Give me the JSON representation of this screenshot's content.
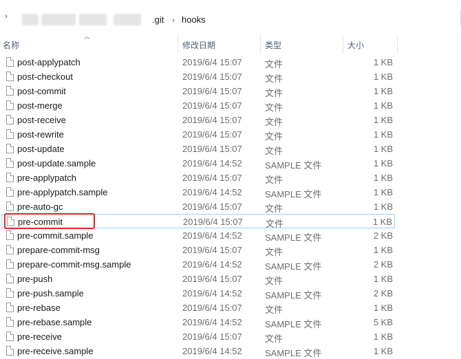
{
  "address": {
    "crumbs": [
      ".git",
      "hooks"
    ],
    "separator": "›",
    "chevron": "›"
  },
  "columns": {
    "name": "名称",
    "date": "修改日期",
    "type": "类型",
    "size": "大小"
  },
  "files": [
    {
      "name": "post-applypatch",
      "date": "2019/6/4 15:07",
      "type": "文件",
      "size": "1 KB"
    },
    {
      "name": "post-checkout",
      "date": "2019/6/4 15:07",
      "type": "文件",
      "size": "1 KB"
    },
    {
      "name": "post-commit",
      "date": "2019/6/4 15:07",
      "type": "文件",
      "size": "1 KB"
    },
    {
      "name": "post-merge",
      "date": "2019/6/4 15:07",
      "type": "文件",
      "size": "1 KB"
    },
    {
      "name": "post-receive",
      "date": "2019/6/4 15:07",
      "type": "文件",
      "size": "1 KB"
    },
    {
      "name": "post-rewrite",
      "date": "2019/6/4 15:07",
      "type": "文件",
      "size": "1 KB"
    },
    {
      "name": "post-update",
      "date": "2019/6/4 15:07",
      "type": "文件",
      "size": "1 KB"
    },
    {
      "name": "post-update.sample",
      "date": "2019/6/4 14:52",
      "type": "SAMPLE 文件",
      "size": "1 KB"
    },
    {
      "name": "pre-applypatch",
      "date": "2019/6/4 15:07",
      "type": "文件",
      "size": "1 KB"
    },
    {
      "name": "pre-applypatch.sample",
      "date": "2019/6/4 14:52",
      "type": "SAMPLE 文件",
      "size": "1 KB"
    },
    {
      "name": "pre-auto-gc",
      "date": "2019/6/4 15:07",
      "type": "文件",
      "size": "1 KB"
    },
    {
      "name": "pre-commit",
      "date": "2019/6/4 15:07",
      "type": "文件",
      "size": "1 KB",
      "selected": true
    },
    {
      "name": "pre-commit.sample",
      "date": "2019/6/4 14:52",
      "type": "SAMPLE 文件",
      "size": "2 KB"
    },
    {
      "name": "prepare-commit-msg",
      "date": "2019/6/4 15:07",
      "type": "文件",
      "size": "1 KB"
    },
    {
      "name": "prepare-commit-msg.sample",
      "date": "2019/6/4 14:52",
      "type": "SAMPLE 文件",
      "size": "2 KB"
    },
    {
      "name": "pre-push",
      "date": "2019/6/4 15:07",
      "type": "文件",
      "size": "1 KB"
    },
    {
      "name": "pre-push.sample",
      "date": "2019/6/4 14:52",
      "type": "SAMPLE 文件",
      "size": "2 KB"
    },
    {
      "name": "pre-rebase",
      "date": "2019/6/4 15:07",
      "type": "文件",
      "size": "1 KB"
    },
    {
      "name": "pre-rebase.sample",
      "date": "2019/6/4 14:52",
      "type": "SAMPLE 文件",
      "size": "5 KB"
    },
    {
      "name": "pre-receive",
      "date": "2019/6/4 15:07",
      "type": "文件",
      "size": "1 KB"
    },
    {
      "name": "pre-receive.sample",
      "date": "2019/6/4 14:52",
      "type": "SAMPLE 文件",
      "size": "1 KB"
    }
  ],
  "colors": {
    "highlight": "#e52520",
    "selection": "#99d1ff",
    "header_text": "#4c607a"
  }
}
